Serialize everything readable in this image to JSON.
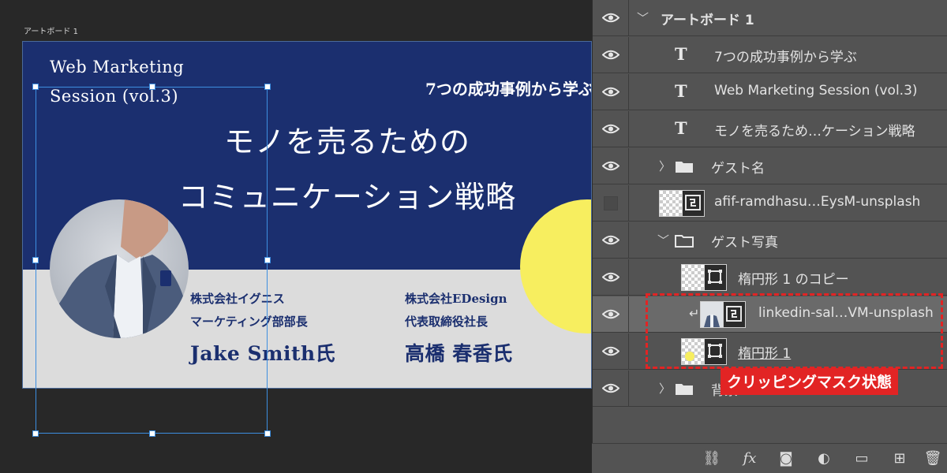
{
  "canvas": {
    "artboard_label": "アートボード 1",
    "series_title": "Web Marketing Session (vol.3)",
    "tagline": "7つの成功事例から学ぶ",
    "main_title_line1": "モノを売るための",
    "main_title_line2": "コミュニケーション戦略",
    "guests": [
      {
        "company": "株式会社イグニス",
        "role": "マーケティング部部長",
        "name": "Jake Smith氏"
      },
      {
        "company": "株式会社EDesign",
        "role": "代表取締役社長",
        "name": "高橋 春香氏"
      }
    ],
    "colors": {
      "banner_navy": "#1b2f6f",
      "accent_yellow": "#f7ee5f",
      "bottom_gray": "#dcdcdc"
    }
  },
  "layers": [
    {
      "name": "アートボード 1",
      "kind": "artboard",
      "visible": true
    },
    {
      "name": "7つの成功事例から学ぶ",
      "kind": "text",
      "visible": true
    },
    {
      "name": "Web Marketing Session (vol.3)",
      "kind": "text",
      "visible": true
    },
    {
      "name": "モノを売るため…ケーション戦略",
      "kind": "text",
      "visible": true
    },
    {
      "name": "ゲスト名",
      "kind": "group-collapsed",
      "visible": true
    },
    {
      "name": "afif-ramdhasu…EysM-unsplash",
      "kind": "smart-object",
      "visible": false
    },
    {
      "name": "ゲスト写真",
      "kind": "group-expanded",
      "visible": true
    },
    {
      "name": "楕円形 1 のコピー",
      "kind": "shape",
      "visible": true
    },
    {
      "name": "linkedin-sal…VM-unsplash",
      "kind": "smart-object-clipped",
      "visible": true
    },
    {
      "name": "楕円形 1",
      "kind": "shape",
      "visible": true
    },
    {
      "name": "背景",
      "kind": "group-collapsed",
      "visible": true
    }
  ],
  "annotation": {
    "label": "クリッピングマスク状態",
    "color": "#e22424"
  },
  "footer_icons": [
    "link-icon",
    "fx-icon",
    "mask-icon",
    "adjustment-icon",
    "new-group-icon",
    "new-layer-icon",
    "trash-icon"
  ]
}
